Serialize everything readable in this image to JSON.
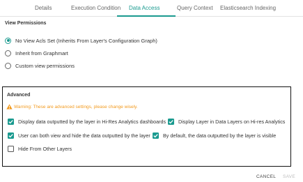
{
  "tabs": [
    {
      "label": "Details",
      "active": false
    },
    {
      "label": "Execution Condition",
      "active": false
    },
    {
      "label": "Data Access",
      "active": true
    },
    {
      "label": "Query Context",
      "active": false
    },
    {
      "label": "Elasticsearch Indexing",
      "active": false
    }
  ],
  "view_permissions": {
    "title": "View Permissions",
    "options": [
      {
        "label": "No View Acls Set (Inherits From Layer's Configuration Graph)",
        "selected": true
      },
      {
        "label": "Inherit from Graphmart",
        "selected": false
      },
      {
        "label": "Custom view permissions",
        "selected": false
      }
    ]
  },
  "advanced": {
    "title": "Advanced",
    "warning": "Warning: These are advanced settings, please change wisely.",
    "checkboxes": [
      {
        "label": "Display data outputted by the layer in Hi-Res Analytics dashboards",
        "checked": true
      },
      {
        "label": "Display Layer in Data Layers on Hi-res Analytics",
        "checked": true
      },
      {
        "label": "User can both view and hide the data outputted by the layer",
        "checked": true
      },
      {
        "label": "By default, the data outputted by the layer is visible",
        "checked": true
      },
      {
        "label": "Hide From Other Layers",
        "checked": false
      }
    ]
  },
  "actions": {
    "cancel_label": "CANCEL",
    "save_label": "SAVE"
  },
  "colors": {
    "accent": "#1a9a8f",
    "warning": "#f29a1e",
    "disabled": "#bdbdbd"
  }
}
